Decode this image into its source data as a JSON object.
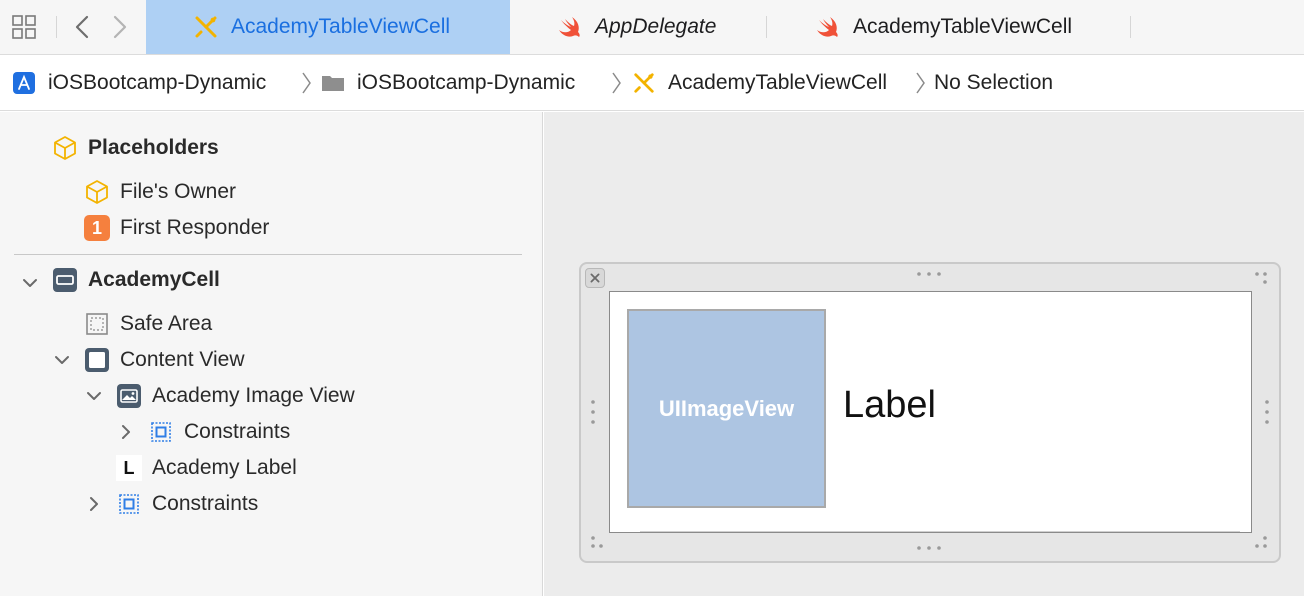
{
  "tabs": [
    {
      "label": "AcademyTableViewCell",
      "icon": "interface-builder-icon",
      "active": true
    },
    {
      "label": "AppDelegate",
      "icon": "swift-icon",
      "active": false,
      "italic": true
    },
    {
      "label": "AcademyTableViewCell",
      "icon": "swift-icon",
      "active": false
    }
  ],
  "breadcrumb": [
    {
      "label": "iOSBootcamp-Dynamic",
      "icon": "xcode-project-icon"
    },
    {
      "label": "iOSBootcamp-Dynamic",
      "icon": "folder-icon"
    },
    {
      "label": "AcademyTableViewCell",
      "icon": "interface-builder-icon"
    },
    {
      "label": "No Selection"
    }
  ],
  "outline": {
    "placeholders": "Placeholders",
    "files_owner": "File's Owner",
    "first_responder": "First Responder",
    "first_responder_badge": "1",
    "academy_cell": "AcademyCell",
    "safe_area": "Safe Area",
    "content_view": "Content View",
    "academy_image_view": "Academy Image View",
    "image_constraints": "Constraints",
    "academy_label_badge": "L",
    "academy_label": "Academy Label",
    "cell_constraints": "Constraints"
  },
  "canvas": {
    "image_view_text": "UIImageView",
    "label_text": "Label"
  },
  "colors": {
    "active_tab_bg": "#aed0f4",
    "active_tab_text": "#1a6fe0",
    "swift_orange": "#f05138",
    "ib_yellow": "#f3b300",
    "image_view_bg": "#adc5e2",
    "responder_orange": "#f5803e"
  }
}
